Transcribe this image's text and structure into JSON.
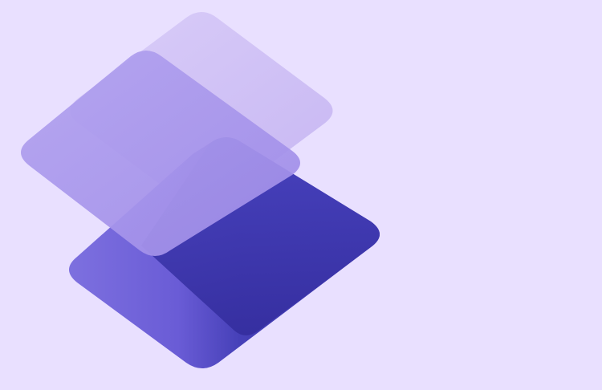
{
  "theme": {
    "background": "#e9e0ff",
    "back_layer_light": "#d1c2f6",
    "middle_layer_light": "#ac98ee",
    "front_layer_deep": "#3d35ad",
    "front_layer_left": "#7163d9"
  },
  "illustration": {
    "type": "stacked-layers-logo",
    "layers": [
      "back-layer",
      "middle-layer",
      "front-layer"
    ]
  }
}
